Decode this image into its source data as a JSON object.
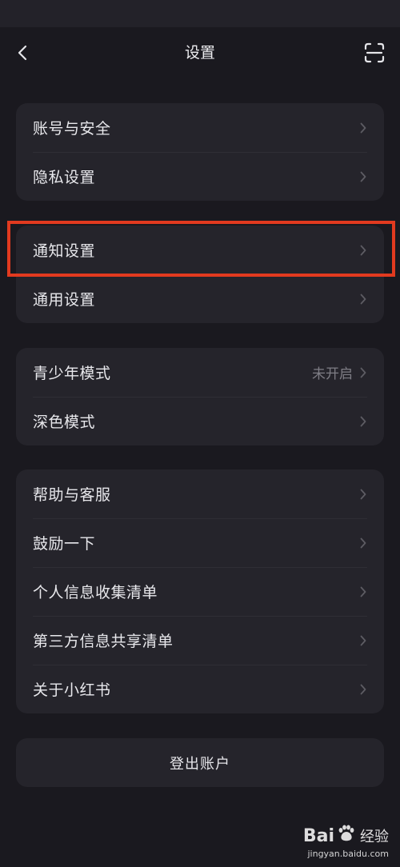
{
  "header": {
    "title": "设置"
  },
  "groups": [
    {
      "items": [
        {
          "label": "账号与安全",
          "value": ""
        },
        {
          "label": "隐私设置",
          "value": ""
        }
      ]
    },
    {
      "items": [
        {
          "label": "通知设置",
          "value": ""
        },
        {
          "label": "通用设置",
          "value": ""
        }
      ]
    },
    {
      "items": [
        {
          "label": "青少年模式",
          "value": "未开启"
        },
        {
          "label": "深色模式",
          "value": ""
        }
      ]
    },
    {
      "items": [
        {
          "label": "帮助与客服",
          "value": ""
        },
        {
          "label": "鼓励一下",
          "value": ""
        },
        {
          "label": "个人信息收集清单",
          "value": ""
        },
        {
          "label": "第三方信息共享清单",
          "value": ""
        },
        {
          "label": "关于小红书",
          "value": ""
        }
      ]
    }
  ],
  "logout_label": "登出账户",
  "watermark": {
    "brand_left": "Bai",
    "brand_right": "经验",
    "url": "jingyan.baidu.com"
  },
  "colors": {
    "background": "#1a191f",
    "card": "#25242b",
    "highlight": "#e23a1f"
  }
}
